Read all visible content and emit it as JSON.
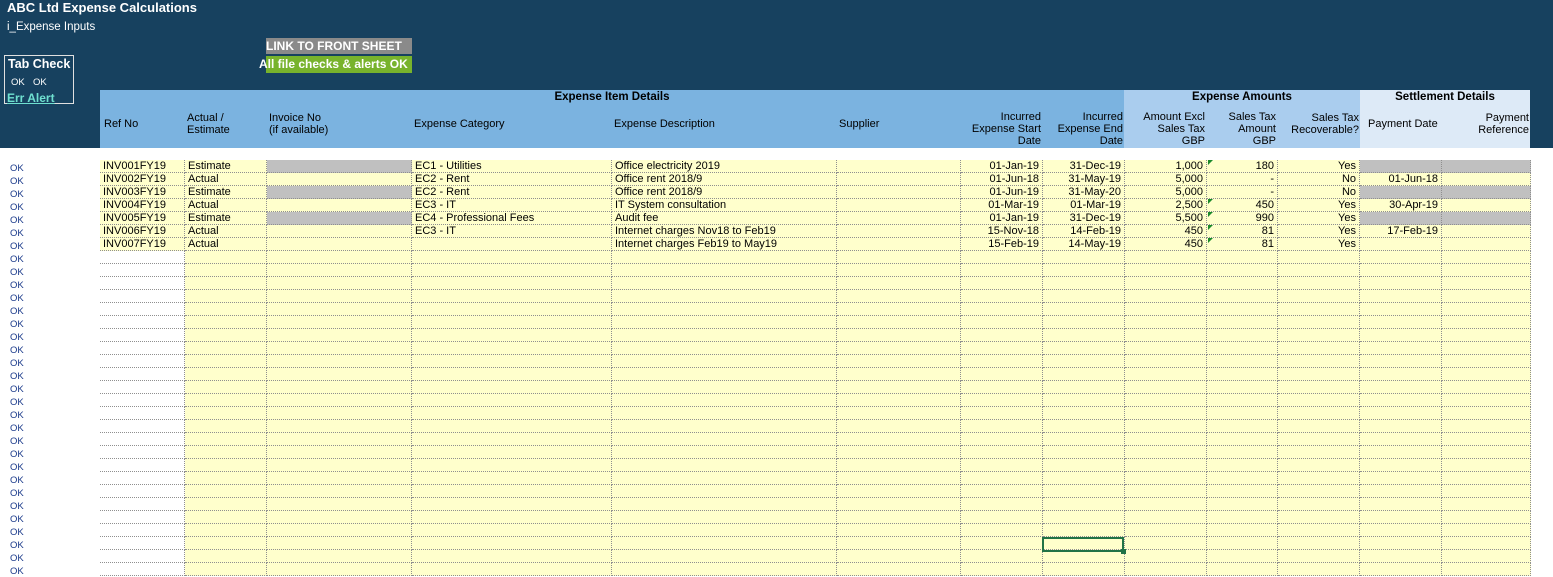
{
  "window": {
    "title": "ABC Ltd Expense Calculations",
    "subtitle": "i_Expense Inputs"
  },
  "tab_check": {
    "title": "Tab Check",
    "ok1": "OK",
    "ok2": "OK",
    "err_alert": "Err Alert"
  },
  "link_button": "LINK TO FRONT SHEET",
  "checks_status": "All file checks & alerts OK",
  "groups": {
    "item_details": "Expense Item Details",
    "amounts": "Expense Amounts",
    "settlement": "Settlement Details"
  },
  "columns": {
    "ref": "Ref No",
    "actual_a": "Actual /",
    "actual_b": "Estimate",
    "invoice_a": "Invoice No",
    "invoice_b": "(if available)",
    "category": "Expense Category",
    "description": "Expense Description",
    "supplier": "Supplier",
    "start_a": "Incurred",
    "start_b": "Expense Start",
    "start_c": "Date",
    "end_a": "Incurred",
    "end_b": "Expense End",
    "end_c": "Date",
    "amount_a": "Amount Excl",
    "amount_b": "Sales Tax",
    "amount_c": "GBP",
    "tax_a": "Sales Tax",
    "tax_b": "Amount",
    "tax_c": "GBP",
    "recov_a": "Sales Tax",
    "recov_b": "Recoverable?",
    "paydate": "Payment Date",
    "payref_a": "Payment",
    "payref_b": "Reference"
  },
  "ok_label": "OK",
  "rows": [
    {
      "ref": "INV001FY19",
      "type": "Estimate",
      "invoice": "",
      "category": "EC1 - Utilities",
      "description": "Office electricity 2019",
      "supplier": "",
      "start": "01-Jan-19",
      "end": "31-Dec-19",
      "amount": "1,000",
      "tax": "180",
      "recoverable": "Yes",
      "paydate": "",
      "payref": ""
    },
    {
      "ref": "INV002FY19",
      "type": "Actual",
      "invoice": "",
      "category": "EC2 - Rent",
      "description": "Office rent 2018/9",
      "supplier": "",
      "start": "01-Jun-18",
      "end": "31-May-19",
      "amount": "5,000",
      "tax": "-",
      "recoverable": "No",
      "paydate": "01-Jun-18",
      "payref": ""
    },
    {
      "ref": "INV003FY19",
      "type": "Estimate",
      "invoice": "",
      "category": "EC2 - Rent",
      "description": "Office rent 2018/9",
      "supplier": "",
      "start": "01-Jun-19",
      "end": "31-May-20",
      "amount": "5,000",
      "tax": "-",
      "recoverable": "No",
      "paydate": "",
      "payref": ""
    },
    {
      "ref": "INV004FY19",
      "type": "Actual",
      "invoice": "",
      "category": "EC3 - IT",
      "description": "IT System consultation",
      "supplier": "",
      "start": "01-Mar-19",
      "end": "01-Mar-19",
      "amount": "2,500",
      "tax": "450",
      "recoverable": "Yes",
      "paydate": "30-Apr-19",
      "payref": ""
    },
    {
      "ref": "INV005FY19",
      "type": "Estimate",
      "invoice": "",
      "category": "EC4 - Professional Fees",
      "description": "Audit fee",
      "supplier": "",
      "start": "01-Jan-19",
      "end": "31-Dec-19",
      "amount": "5,500",
      "tax": "990",
      "recoverable": "Yes",
      "paydate": "",
      "payref": ""
    },
    {
      "ref": "INV006FY19",
      "type": "Actual",
      "invoice": "",
      "category": "EC3 - IT",
      "description": "Internet charges Nov18 to Feb19",
      "supplier": "",
      "start": "15-Nov-18",
      "end": "14-Feb-19",
      "amount": "450",
      "tax": "81",
      "recoverable": "Yes",
      "paydate": "17-Feb-19",
      "payref": ""
    },
    {
      "ref": "INV007FY19",
      "type": "Actual",
      "invoice": "",
      "category": "",
      "description": "Internet charges Feb19 to May19",
      "supplier": "",
      "start": "15-Feb-19",
      "end": "14-May-19",
      "amount": "450",
      "tax": "81",
      "recoverable": "Yes",
      "paydate": "",
      "payref": ""
    }
  ],
  "empty_row_count": 25,
  "colors": {
    "banner": "#17415f",
    "header_main": "#7bb3e0",
    "header_amounts": "#aacdee",
    "header_settlement": "#ddeaf7",
    "input_cell": "#ffffcc",
    "grey_cell": "#c0c0c0",
    "checks_green": "#78b32c"
  }
}
